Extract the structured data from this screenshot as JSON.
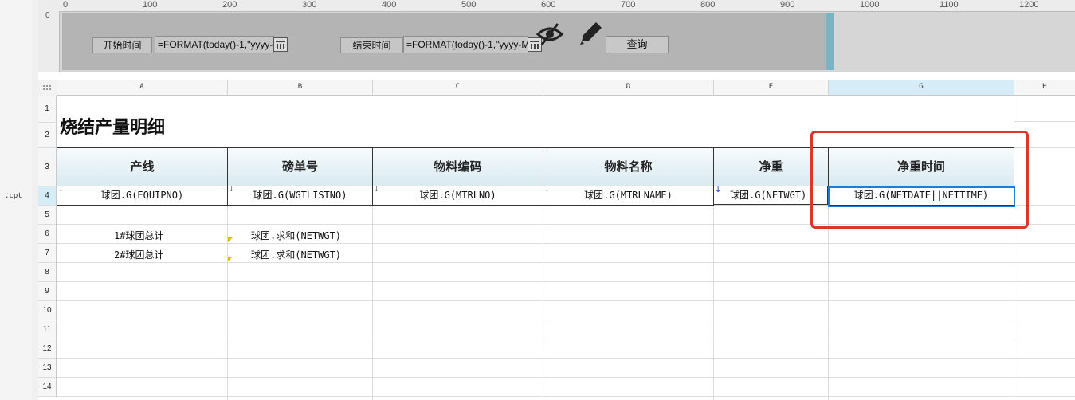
{
  "left_panel": {
    "file_suffix": ".cpt"
  },
  "ruler": {
    "ticks": [
      "0",
      "100",
      "200",
      "300",
      "400",
      "500",
      "600",
      "700",
      "800",
      "900",
      "1000",
      "1100",
      "1200"
    ],
    "vertical_zero": "0"
  },
  "params": {
    "start_label": "开始时间",
    "start_value": "=FORMAT(today()-1,\"yyyy-",
    "end_label": "结束时间",
    "end_value": "=FORMAT(today()-1,\"yyyy-M",
    "query_button": "查询"
  },
  "sheet": {
    "columns": [
      "A",
      "B",
      "C",
      "D",
      "E",
      "G",
      "H"
    ],
    "selected_column": "G",
    "rows": [
      "1",
      "2",
      "3",
      "4",
      "5",
      "6",
      "7",
      "8",
      "9",
      "10",
      "11",
      "12",
      "13",
      "14"
    ],
    "selected_row": "4",
    "title": "烧结产量明细",
    "headers": [
      "产线",
      "磅单号",
      "物料编码",
      "物料名称",
      "净重",
      "净重时间"
    ],
    "data_row": [
      "球团.G(EQUIPNO)",
      "球团.G(WGTLISTNO)",
      "球团.G(MTRLNO)",
      "球团.G(MTRLNAME)",
      "球团.G(NETWGT)",
      "球团.G(NETDATE||NETTIME)"
    ],
    "summary": [
      {
        "label": "1#球团总计",
        "value": "球团.求和(NETWGT)"
      },
      {
        "label": "2#球团总计",
        "value": "球团.求和(NETWGT)"
      }
    ]
  },
  "colors": {
    "highlight": "#e0352b",
    "selection": "#1e7bd6",
    "header_top": "#f7fbfd",
    "header_bottom": "#d9eaf1"
  }
}
